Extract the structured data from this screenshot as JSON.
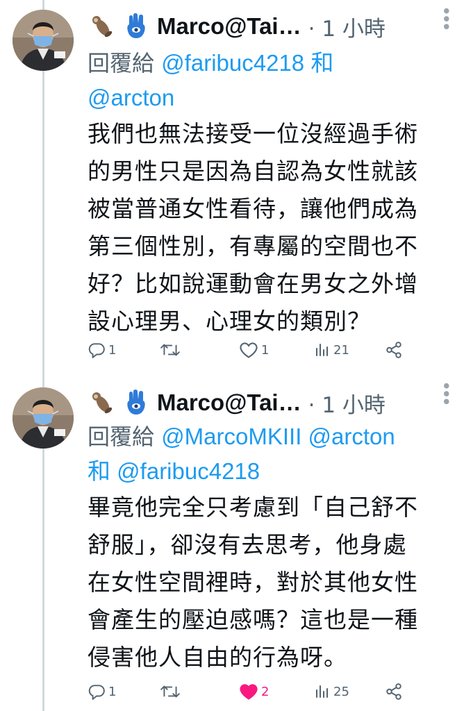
{
  "tweets": [
    {
      "display_name": "Marco@Tai…",
      "timestamp": "1 小時",
      "reply_prefix": "回覆給",
      "reply_mentions_line1": "@faribuc4218 和",
      "reply_mentions_line2": "@arcton",
      "text_lines": [
        "我們也無法接受一位沒經過手術",
        "的男性只是因為自認為女性就該",
        "被當普通女性看待，讓他們成為",
        "第三個性別，有專屬的空間也不",
        "好？比如說運動會在男女之外增",
        "設心理男、心理女的類別？"
      ],
      "reply_count": "1",
      "retweet_count": "",
      "like_count": "1",
      "view_count": "21",
      "liked": false
    },
    {
      "display_name": "Marco@Tai…",
      "timestamp": "1 小時",
      "reply_prefix": "回覆給",
      "reply_mentions_line1": "@MarcoMKIII @arcton",
      "reply_mentions_line2": "和 @faribuc4218",
      "text_lines": [
        "畢竟他完全只考慮到「自己舒不",
        "舒服」，卻沒有去思考，他身處",
        "在女性空間裡時，對於其他女性",
        "會產生的壓迫感嗎？這也是一種",
        "侵害他人自由的行為呀。"
      ],
      "reply_count": "1",
      "retweet_count": "",
      "like_count": "2",
      "view_count": "25",
      "liked": true
    }
  ],
  "icons": {
    "name_emoji_1": "otter-emoji",
    "name_emoji_2": "hamsa-hand-emoji",
    "reply": "reply-bubble-icon",
    "retweet": "retweet-icon",
    "like": "heart-icon",
    "views": "views-chart-icon",
    "share": "share-icon",
    "more": "more-dots-icon"
  },
  "colors": {
    "text": "#0f1419",
    "secondary": "#536471",
    "link": "#1d9bf0",
    "like": "#f91880",
    "thread_line": "#cfd9de"
  }
}
